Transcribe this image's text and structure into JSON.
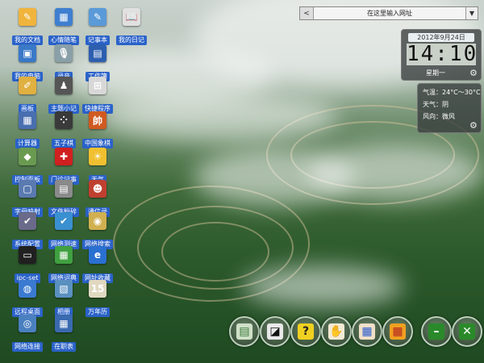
{
  "desktop_icons": [
    {
      "label": "我的文档",
      "glyph": "✎",
      "color": "#f0b43c"
    },
    {
      "label": "心情随笔",
      "glyph": "▦",
      "color": "#3f7fd0"
    },
    {
      "label": "记事本",
      "glyph": "✎",
      "color": "#5a9ad8"
    },
    {
      "label": "我的日记",
      "glyph": "📖",
      "color": "#e0e0e0"
    },
    {
      "label": "我的电脑",
      "glyph": "▣",
      "color": "#3a78c8"
    },
    {
      "label": "录音",
      "glyph": "🎙",
      "color": "#8aa0a8"
    },
    {
      "label": "工作簿",
      "glyph": "▤",
      "color": "#2d5fb0"
    },
    {
      "label": "画板",
      "glyph": "✐",
      "color": "#e0b040"
    },
    {
      "label": "主题小记",
      "glyph": "♟",
      "color": "#555"
    },
    {
      "label": "快捷程序",
      "glyph": "⊞",
      "color": "#d8d8d8"
    },
    {
      "label": "计算器",
      "glyph": "▦",
      "color": "#4a6fb0"
    },
    {
      "label": "五子棋",
      "glyph": "⁘",
      "color": "#3a3a3a"
    },
    {
      "label": "中国象棋",
      "glyph": "帥",
      "color": "#d05a20"
    },
    {
      "label": "控制面板",
      "glyph": "◆",
      "color": "#6a9a50"
    },
    {
      "label": "门诊记事",
      "glyph": "✚",
      "color": "#d02020"
    },
    {
      "label": "天气",
      "glyph": "☀",
      "color": "#f0c030"
    },
    {
      "label": "字母映射",
      "glyph": "▢",
      "color": "#5a7ab0"
    },
    {
      "label": "文件粉碎",
      "glyph": "▤",
      "color": "#8a8a8a"
    },
    {
      "label": "通信录",
      "glyph": "☻",
      "color": "#c04030"
    },
    {
      "label": "系统配置",
      "glyph": "✔",
      "color": "#6a6a8a"
    },
    {
      "label": "网络测速",
      "glyph": "✔",
      "color": "#3a90d0"
    },
    {
      "label": "网络搜索",
      "glyph": "◉",
      "color": "#d0b050"
    },
    {
      "label": "ipc-set",
      "glyph": "▭",
      "color": "#202020"
    },
    {
      "label": "网络词典",
      "glyph": "▦",
      "color": "#40a040"
    },
    {
      "label": "网址收藏",
      "glyph": "e",
      "color": "#2a70d0"
    },
    {
      "label": "远程桌面",
      "glyph": "◍",
      "color": "#3a7ad0"
    },
    {
      "label": "相册",
      "glyph": "▧",
      "color": "#5a90c0"
    },
    {
      "label": "万年历",
      "glyph": "15",
      "color": "#e0d8c0"
    },
    {
      "label": "网络连接",
      "glyph": "◎",
      "color": "#4a80c0"
    },
    {
      "label": "在职表",
      "glyph": "▦",
      "color": "#3a6ab0"
    }
  ],
  "search": {
    "placeholder": "在这里输入网址",
    "back_glyph": "<",
    "drop_glyph": "▼"
  },
  "clock": {
    "date": "2012年9月24日",
    "time": "14:10",
    "weekday": "星期一"
  },
  "weather": {
    "temp": "气温：24°C～30°C",
    "sky": "天气：阴",
    "wind": "风向：微风"
  },
  "dock": [
    {
      "name": "keyboard",
      "glyph": "▤",
      "color": "#3a7a3a",
      "bg": "#cfe0c8"
    },
    {
      "name": "notes",
      "glyph": "◪",
      "color": "#111",
      "bg": "#e8e8e8"
    },
    {
      "name": "help",
      "glyph": "?",
      "color": "#222",
      "bg": "#f0d020"
    },
    {
      "name": "handshake",
      "glyph": "✋",
      "color": "#c89a50",
      "bg": "#f3ead5"
    },
    {
      "name": "windows",
      "glyph": "▦",
      "color": "#2a5ad0",
      "bg": "#f0e0c8"
    },
    {
      "name": "shop",
      "glyph": "▦",
      "color": "#b02020",
      "bg": "#f0a020"
    },
    {
      "name": "minimize",
      "glyph": "–",
      "color": "#fff",
      "bg": "#2a8a2a"
    },
    {
      "name": "close",
      "glyph": "✕",
      "color": "#fff",
      "bg": "#2a8a2a"
    }
  ]
}
